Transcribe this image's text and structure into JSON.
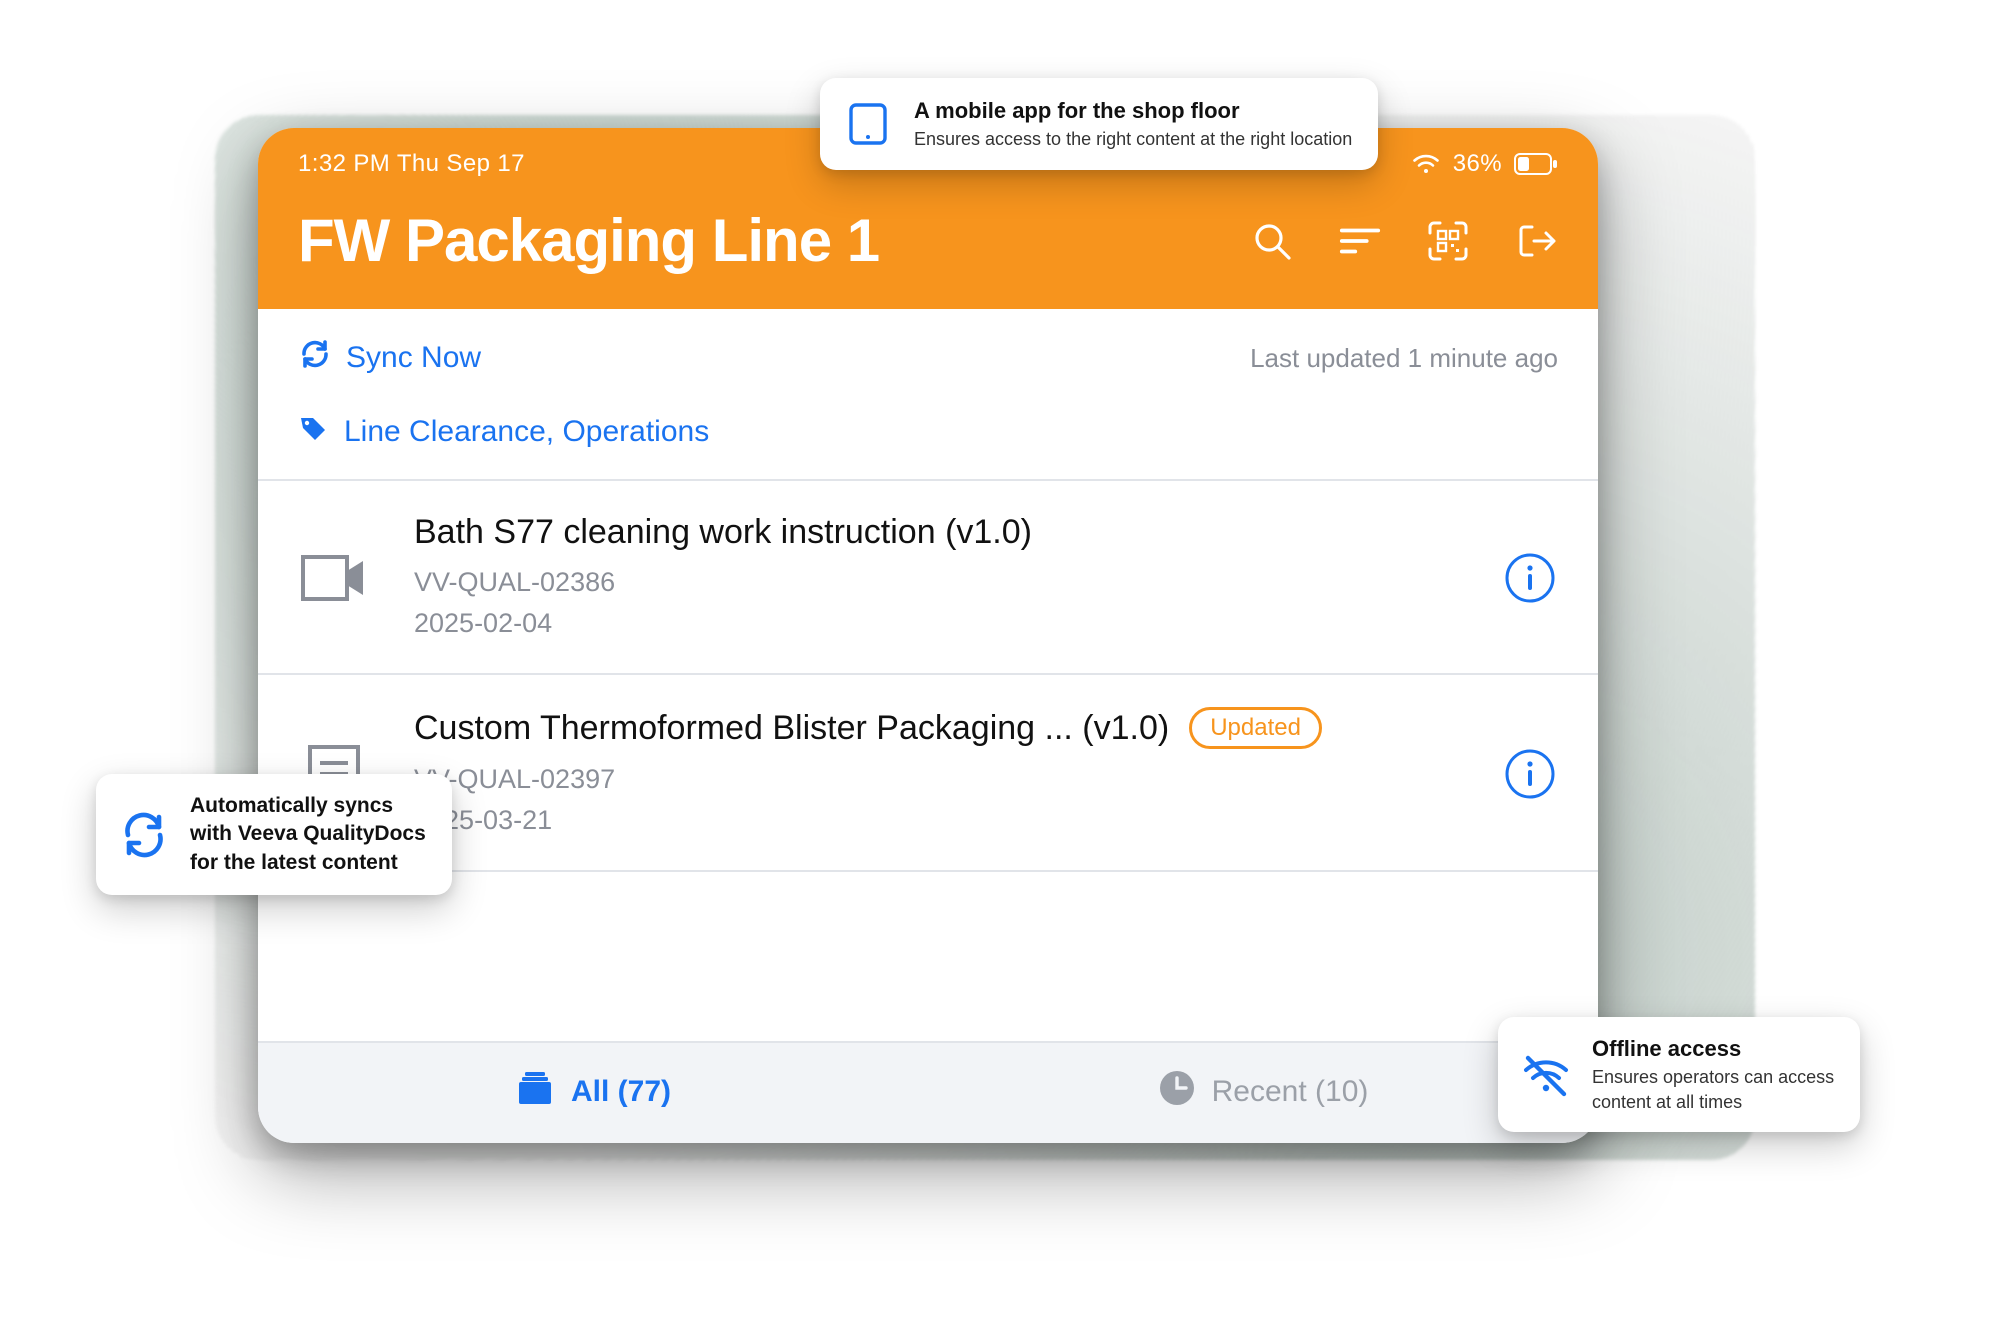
{
  "statusbar": {
    "time_day": "1:32 PM  Thu Sep 17",
    "battery_pct": "36%"
  },
  "header": {
    "title": "FW Packaging Line 1"
  },
  "sync": {
    "label": "Sync Now",
    "last_updated": "Last updated 1 minute ago"
  },
  "tags": {
    "text": "Line Clearance, Operations"
  },
  "docs": [
    {
      "icon": "video",
      "title": "Bath S77 cleaning work instruction (v1.0)",
      "id": "VV-QUAL-02386",
      "date": "2025-02-04",
      "badge": ""
    },
    {
      "icon": "document",
      "title": "Custom Thermoformed Blister Packaging ... (v1.0)",
      "id": "VV-QUAL-02397",
      "date": "2025-03-21",
      "badge": "Updated"
    }
  ],
  "tabs": {
    "all_label": "All (77)",
    "recent_label": "Recent (10)"
  },
  "callouts": {
    "top": {
      "title": "A mobile app for the shop floor",
      "sub": "Ensures access to the right content at the right location"
    },
    "left": {
      "line1": "Automatically syncs",
      "line2": "with Veeva QualityDocs",
      "line3": "for the latest content"
    },
    "right": {
      "title": "Offline access",
      "sub1": "Ensures operators can access",
      "sub2": "content at all times"
    }
  },
  "colors": {
    "accent_orange": "#f7941d",
    "accent_blue": "#1a73f0"
  }
}
